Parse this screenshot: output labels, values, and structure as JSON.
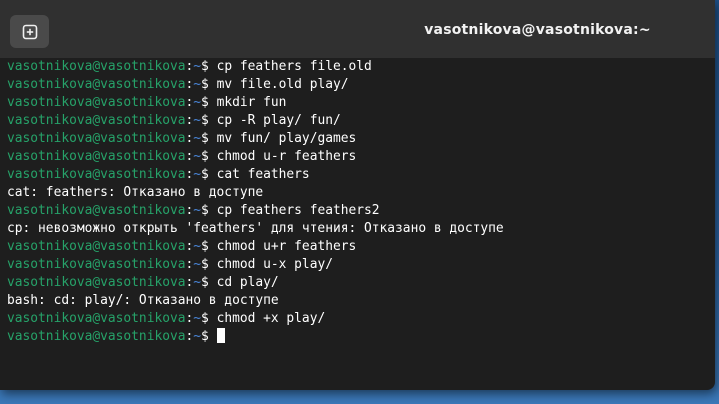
{
  "window": {
    "title": "vasotnikova@vasotnikova:~",
    "new_tab_icon": "plus-square-icon"
  },
  "colors": {
    "terminal_bg": "#1e1e1e",
    "titlebar_bg": "#303030",
    "prompt_user": "#26a269",
    "prompt_path": "#4a86d9",
    "text": "#ffffff"
  },
  "terminal": {
    "lines": [
      {
        "type": "prompt",
        "user": "vasotnikova@vasotnikova",
        "path": "~",
        "symbol": "$",
        "command": "cp feathers file.old"
      },
      {
        "type": "prompt",
        "user": "vasotnikova@vasotnikova",
        "path": "~",
        "symbol": "$",
        "command": "mv file.old play/"
      },
      {
        "type": "prompt",
        "user": "vasotnikova@vasotnikova",
        "path": "~",
        "symbol": "$",
        "command": "mkdir fun"
      },
      {
        "type": "prompt",
        "user": "vasotnikova@vasotnikova",
        "path": "~",
        "symbol": "$",
        "command": "cp -R play/ fun/"
      },
      {
        "type": "prompt",
        "user": "vasotnikova@vasotnikova",
        "path": "~",
        "symbol": "$",
        "command": "mv fun/ play/games"
      },
      {
        "type": "prompt",
        "user": "vasotnikova@vasotnikova",
        "path": "~",
        "symbol": "$",
        "command": "chmod u-r feathers"
      },
      {
        "type": "prompt",
        "user": "vasotnikova@vasotnikova",
        "path": "~",
        "symbol": "$",
        "command": "cat feathers"
      },
      {
        "type": "output",
        "text": "cat: feathers: Отказано в доступе"
      },
      {
        "type": "prompt",
        "user": "vasotnikova@vasotnikova",
        "path": "~",
        "symbol": "$",
        "command": "cp feathers feathers2"
      },
      {
        "type": "output",
        "text": "cp: невозможно открыть 'feathers' для чтения: Отказано в доступе"
      },
      {
        "type": "prompt",
        "user": "vasotnikova@vasotnikova",
        "path": "~",
        "symbol": "$",
        "command": "chmod u+r feathers"
      },
      {
        "type": "prompt",
        "user": "vasotnikova@vasotnikova",
        "path": "~",
        "symbol": "$",
        "command": "chmod u-x play/"
      },
      {
        "type": "prompt",
        "user": "vasotnikova@vasotnikova",
        "path": "~",
        "symbol": "$",
        "command": "cd play/"
      },
      {
        "type": "output",
        "text": "bash: cd: play/: Отказано в доступе"
      },
      {
        "type": "prompt",
        "user": "vasotnikova@vasotnikova",
        "path": "~",
        "symbol": "$",
        "command": "chmod +x play/"
      },
      {
        "type": "prompt",
        "user": "vasotnikova@vasotnikova",
        "path": "~",
        "symbol": "$",
        "command": "",
        "cursor": true
      }
    ]
  }
}
